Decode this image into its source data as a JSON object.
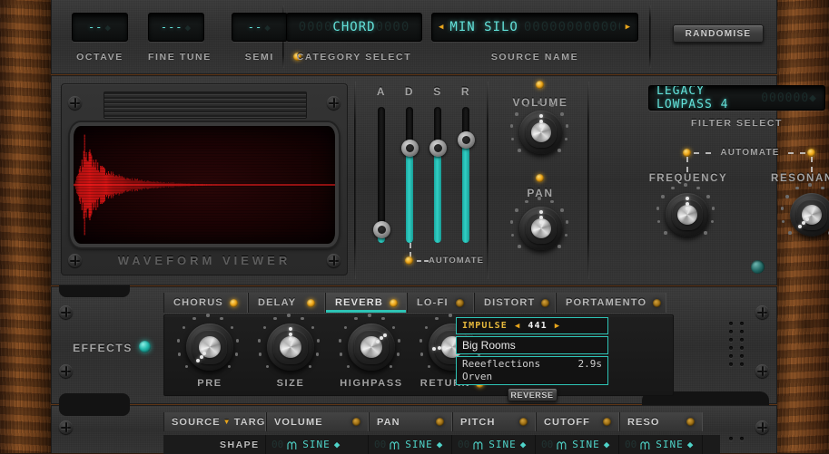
{
  "header": {
    "octave": {
      "label": "OCTAVE",
      "value": "--",
      "ghost": ""
    },
    "fine_tune": {
      "label": "FINE TUNE",
      "value": "---",
      "ghost": ""
    },
    "semi": {
      "label": "SEMI",
      "value": "--",
      "ghost": ""
    },
    "category": {
      "label": "CATEGORY SELECT",
      "value": "CHORD",
      "ghost_left": "0000",
      "ghost_right": "0000"
    },
    "source": {
      "label": "SOURCE NAME",
      "value": "MIN SILO",
      "ghost_right": "000000000000000",
      "prev": "◀",
      "next": "▶"
    },
    "randomise": "RANDOMISE"
  },
  "waveform": {
    "label": "WAVEFORM VIEWER"
  },
  "envelope": {
    "sliders": [
      {
        "label": "A",
        "value": 10
      },
      {
        "label": "D",
        "value": 70
      },
      {
        "label": "S",
        "value": 70
      },
      {
        "label": "R",
        "value": 76
      }
    ],
    "automate_label": "AUTOMATE"
  },
  "amp": {
    "volume": {
      "label": "VOLUME",
      "angle": 0
    },
    "pan": {
      "label": "PAN",
      "angle": 0
    }
  },
  "filter": {
    "select_label": "FILTER SELECT",
    "select_value": "LEGACY LOWPASS 4",
    "select_ghost": "000000",
    "automate_label": "AUTOMATE",
    "frequency": {
      "label": "FREQUENCY",
      "angle": 0
    },
    "resonance": {
      "label": "RESONANCE",
      "angle": -135
    }
  },
  "effects": {
    "label": "EFFECTS",
    "tabs": [
      {
        "label": "CHORUS",
        "active": false,
        "led": "amber"
      },
      {
        "label": "DELAY",
        "active": false,
        "led": "amber"
      },
      {
        "label": "REVERB",
        "active": true,
        "led": "amber"
      },
      {
        "label": "LO-FI",
        "active": false,
        "led": "amber-dim"
      },
      {
        "label": "DISTORT",
        "active": false,
        "led": "amber-dim"
      },
      {
        "label": "PORTAMENTO",
        "active": false,
        "led": "amber-dim"
      }
    ],
    "knobs": [
      {
        "label": "PRE",
        "angle": -140,
        "led": false
      },
      {
        "label": "SIZE",
        "angle": 0,
        "led": false
      },
      {
        "label": "HIGHPASS",
        "angle": 48,
        "led": false
      },
      {
        "label": "RETURN",
        "angle": -95,
        "led": true
      }
    ],
    "impulse": {
      "title": "IMPULSE",
      "number": "441",
      "prev": "◀",
      "next": "▶",
      "category": "Big Rooms",
      "name": "Reeeflections",
      "duration": "2.9s",
      "author": "Orven",
      "reverse_button": "REVERSE"
    }
  },
  "mod_matrix": {
    "source_label": "SOURCE",
    "target_label": "TARGET",
    "source_arrow": "▼",
    "target_arrow": "▶",
    "columns": [
      {
        "label": "VOLUME",
        "shape": "SINE",
        "ghost": "00"
      },
      {
        "label": "PAN",
        "shape": "SINE",
        "ghost": "00"
      },
      {
        "label": "PITCH",
        "shape": "SINE",
        "ghost": "00"
      },
      {
        "label": "CUTOFF",
        "shape": "SINE",
        "ghost": "00"
      },
      {
        "label": "RESO",
        "shape": "SINE",
        "ghost": "00"
      }
    ],
    "row_label": "SHAPE"
  },
  "colors": {
    "teal": "#2ec4b6",
    "amber": "#f0a81a",
    "lcd": "#62e0d8",
    "wave_red": "#e01a1a"
  }
}
